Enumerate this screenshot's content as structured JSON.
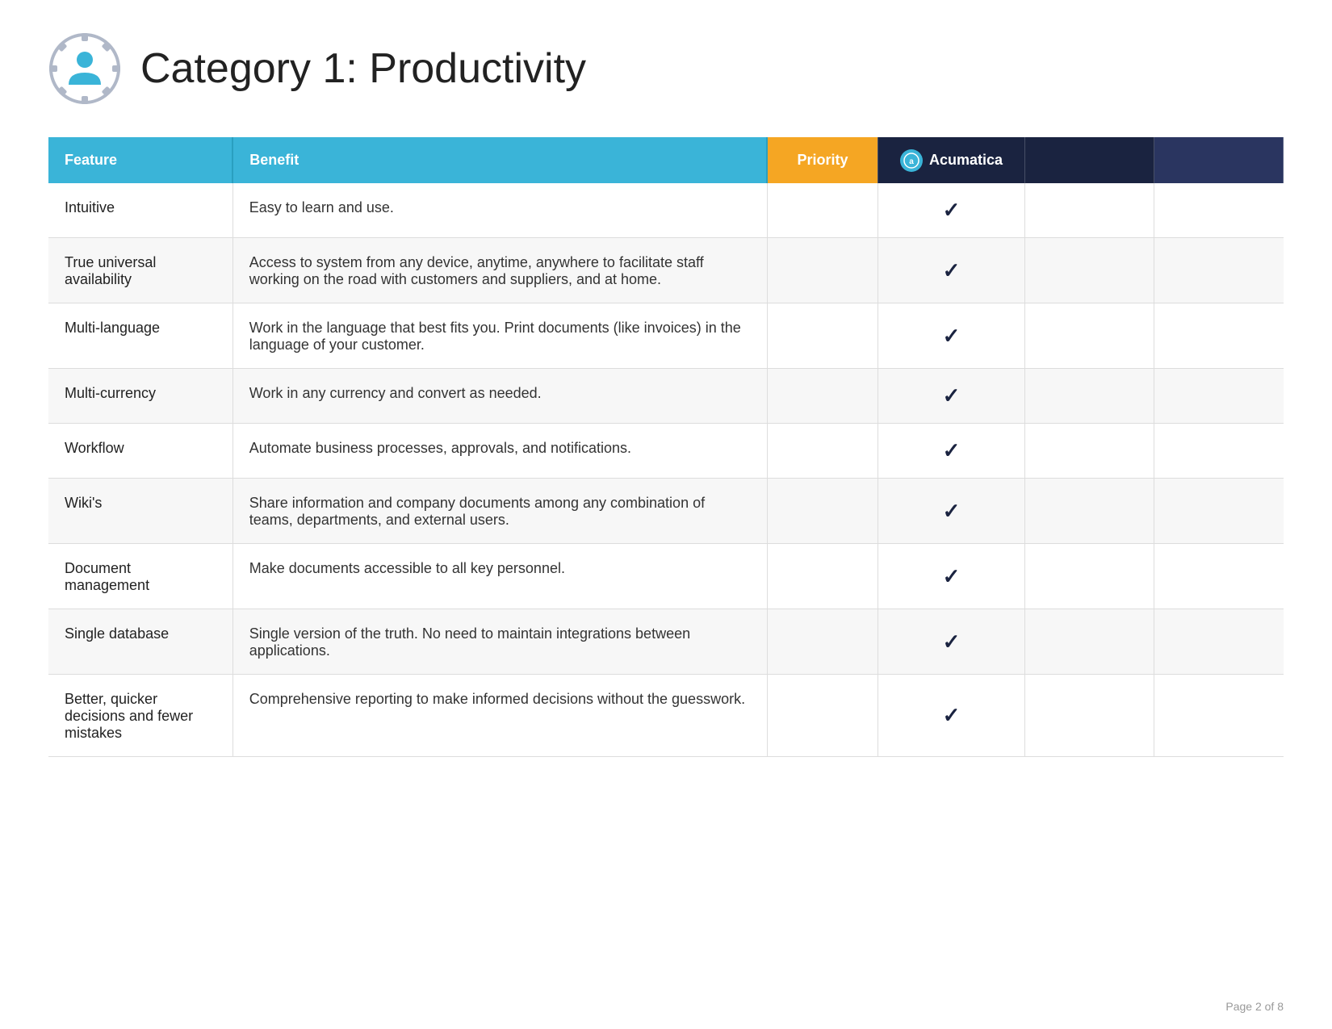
{
  "header": {
    "title": "Category 1: Productivity",
    "icon_alt": "productivity-icon"
  },
  "table": {
    "columns": {
      "feature": "Feature",
      "benefit": "Benefit",
      "priority": "Priority",
      "acumatica": "Acumatica",
      "vendor2": "",
      "vendor3": ""
    },
    "rows": [
      {
        "feature": "Intuitive",
        "benefit": "Easy to learn and use.",
        "priority": false,
        "acumatica": true,
        "vendor2": false,
        "vendor3": false
      },
      {
        "feature": "True universal availability",
        "benefit": "Access to system from any device, anytime, anywhere to facilitate staff working on the road with customers and suppliers, and at home.",
        "priority": false,
        "acumatica": true,
        "vendor2": false,
        "vendor3": false
      },
      {
        "feature": "Multi-language",
        "benefit": "Work in the language that best fits you. Print documents (like invoices) in the language of your customer.",
        "priority": false,
        "acumatica": true,
        "vendor2": false,
        "vendor3": false
      },
      {
        "feature": "Multi-currency",
        "benefit": "Work in any currency and convert as needed.",
        "priority": false,
        "acumatica": true,
        "vendor2": false,
        "vendor3": false
      },
      {
        "feature": "Workflow",
        "benefit": "Automate business processes, approvals, and notifications.",
        "priority": false,
        "acumatica": true,
        "vendor2": false,
        "vendor3": false
      },
      {
        "feature": "Wiki's",
        "benefit": "Share information and company documents among any combination of teams, departments, and external users.",
        "priority": false,
        "acumatica": true,
        "vendor2": false,
        "vendor3": false
      },
      {
        "feature": "Document management",
        "benefit": "Make documents accessible to all key personnel.",
        "priority": false,
        "acumatica": true,
        "vendor2": false,
        "vendor3": false
      },
      {
        "feature": "Single database",
        "benefit": "Single version of the truth. No need to maintain integrations between applications.",
        "priority": false,
        "acumatica": true,
        "vendor2": false,
        "vendor3": false
      },
      {
        "feature": "Better, quicker decisions and fewer mistakes",
        "benefit": "Comprehensive reporting to make informed decisions without the guesswork.",
        "priority": false,
        "acumatica": true,
        "vendor2": false,
        "vendor3": false
      }
    ]
  },
  "footer": {
    "page_info": "Page 2 of 8"
  },
  "colors": {
    "header_bg": "#3ab4d8",
    "priority_bg": "#f5a623",
    "vendor_bg": "#1a2340",
    "check_color": "#1a2340"
  }
}
